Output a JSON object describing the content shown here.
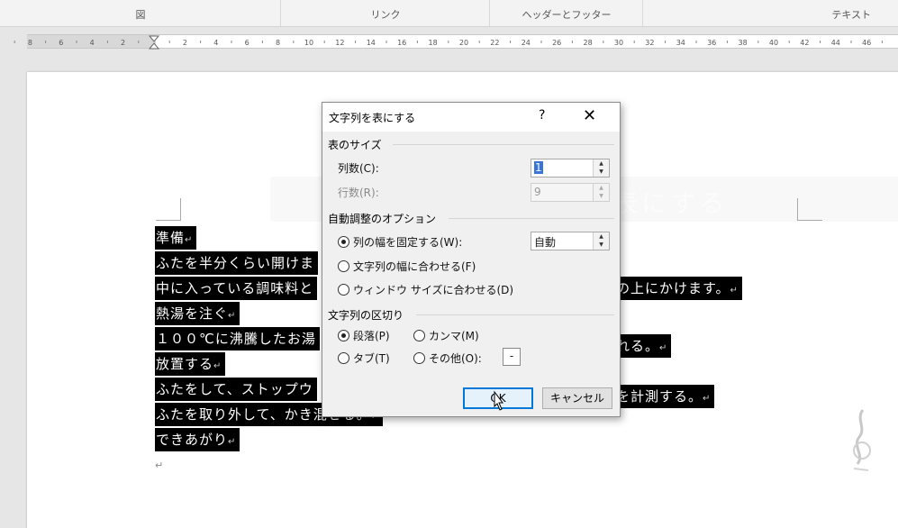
{
  "ribbon": {
    "groups": [
      "図",
      "リンク",
      "ヘッダーとフッター",
      "テキスト"
    ]
  },
  "ruler": {
    "left_labels": [
      "8",
      "6",
      "4",
      "2"
    ],
    "right_labels": [
      "2",
      "4",
      "6",
      "8",
      "10",
      "12",
      "14",
      "16",
      "18",
      "20",
      "22",
      "24",
      "26",
      "28",
      "30",
      "32",
      "34",
      "36",
      "38",
      "40",
      "42",
      "44",
      "46"
    ]
  },
  "document": {
    "ghost_text": "表にする",
    "lines": [
      "準備",
      "ふたを半分くらい開けま",
      "中に入っている調味料と",
      "熱湯を注ぐ",
      "１００℃に沸騰したお湯",
      "放置する",
      "ふたをして、ストップウ",
      "ふたを取り外して、かき混ぜる。",
      "できあがり"
    ],
    "right_fragments": {
      "2": "の上にかけます。",
      "4": "れる。",
      "6": "を計測する。"
    },
    "paragraph_mark": "↵"
  },
  "dialog": {
    "title": "文字列を表にする",
    "help": "?",
    "close": "✕",
    "size_group": "表のサイズ",
    "columns_label": "列数(C):",
    "columns_value": "1",
    "rows_label": "行数(R):",
    "rows_value": "9",
    "autofit_group": "自動調整のオプション",
    "autofit_fixed": "列の幅を固定する(W):",
    "autofit_fixed_value": "自動",
    "autofit_contents": "文字列の幅に合わせる(F)",
    "autofit_window": "ウィンドウ サイズに合わせる(D)",
    "separator_group": "文字列の区切り",
    "sep_paragraph": "段落(P)",
    "sep_comma": "カンマ(M)",
    "sep_tab": "タブ(T)",
    "sep_other": "その他(O):",
    "sep_other_value": "-",
    "ok": "OK",
    "cancel": "キャンセル"
  },
  "colors": {
    "selection_bg": "#000000",
    "selection_fg": "#ffffff",
    "primary_button_border": "#0078d7"
  }
}
